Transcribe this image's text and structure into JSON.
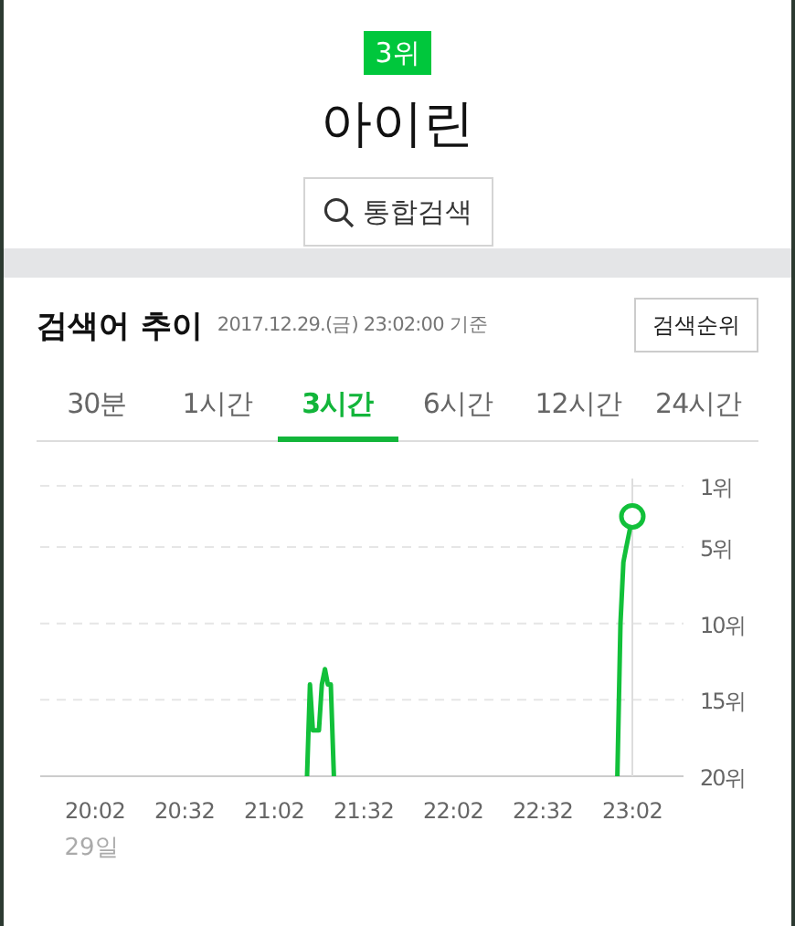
{
  "rank_badge": "3위",
  "keyword": "아이린",
  "search_button": {
    "label": "통합검색"
  },
  "trend": {
    "title": "검색어 추이",
    "timestamp": "2017.12.29.(금) 23:02:00 기준",
    "rank_button": "검색순위",
    "tabs": [
      {
        "label": "30분",
        "selected": false
      },
      {
        "label": "1시간",
        "selected": false
      },
      {
        "label": "3시간",
        "selected": true
      },
      {
        "label": "6시간",
        "selected": false
      },
      {
        "label": "12시간",
        "selected": false
      },
      {
        "label": "24시간",
        "selected": false
      }
    ],
    "date_label": "29일",
    "chart_data": {
      "type": "line",
      "categories": [
        "20:02",
        null,
        null,
        null,
        null,
        null,
        null,
        null,
        null,
        null,
        null,
        null,
        null,
        null,
        null,
        null,
        null,
        null,
        null,
        null,
        null,
        null,
        null,
        null,
        null,
        null,
        null,
        null,
        null,
        null,
        "20:32",
        null,
        null,
        null,
        null,
        null,
        null,
        null,
        null,
        null,
        null,
        null,
        null,
        null,
        null,
        null,
        null,
        null,
        null,
        null,
        null,
        null,
        null,
        null,
        null,
        null,
        null,
        null,
        null,
        null,
        "21:02",
        null,
        null,
        null,
        null,
        null,
        null,
        null,
        null,
        null,
        null,
        null,
        null,
        null,
        null,
        null,
        null,
        null,
        null,
        null,
        null,
        null,
        null,
        null,
        null,
        null,
        null,
        null,
        null,
        null,
        "21:32",
        null,
        null,
        null,
        null,
        null,
        null,
        null,
        null,
        null,
        null,
        null,
        null,
        null,
        null,
        null,
        null,
        null,
        null,
        null,
        null,
        null,
        null,
        null,
        null,
        null,
        null,
        null,
        null,
        null,
        "22:02",
        null,
        null,
        null,
        null,
        null,
        null,
        null,
        null,
        null,
        null,
        null,
        null,
        null,
        null,
        null,
        null,
        null,
        null,
        null,
        null,
        null,
        null,
        null,
        null,
        null,
        null,
        null,
        null,
        null,
        "22:32",
        null,
        null,
        null,
        null,
        null,
        null,
        null,
        null,
        null,
        null,
        null,
        null,
        null,
        null,
        null,
        null,
        null,
        null,
        null,
        null,
        null,
        null,
        null,
        null,
        null,
        null,
        null,
        null,
        null,
        "23:02"
      ],
      "series": [
        {
          "color": "#12c03a",
          "values": [
            null,
            null,
            null,
            null,
            null,
            null,
            null,
            null,
            null,
            null,
            null,
            null,
            null,
            null,
            null,
            null,
            null,
            null,
            null,
            null,
            null,
            null,
            null,
            null,
            null,
            null,
            null,
            null,
            null,
            null,
            null,
            null,
            null,
            null,
            null,
            null,
            null,
            null,
            null,
            null,
            null,
            null,
            null,
            null,
            null,
            null,
            null,
            null,
            null,
            null,
            null,
            null,
            null,
            null,
            null,
            null,
            null,
            null,
            null,
            null,
            null,
            null,
            null,
            null,
            null,
            null,
            null,
            null,
            null,
            null,
            null,
            20,
            14,
            17,
            17,
            17,
            14,
            13,
            14,
            14,
            20,
            null,
            null,
            null,
            null,
            null,
            null,
            null,
            null,
            null,
            null,
            null,
            null,
            null,
            null,
            null,
            null,
            null,
            null,
            null,
            null,
            null,
            null,
            null,
            null,
            null,
            null,
            null,
            null,
            null,
            null,
            null,
            null,
            null,
            null,
            null,
            null,
            null,
            null,
            null,
            null,
            null,
            null,
            null,
            null,
            null,
            null,
            null,
            null,
            null,
            null,
            null,
            null,
            null,
            null,
            null,
            null,
            null,
            null,
            null,
            null,
            null,
            null,
            null,
            null,
            null,
            null,
            null,
            null,
            null,
            null,
            null,
            null,
            null,
            null,
            null,
            null,
            null,
            null,
            null,
            null,
            null,
            null,
            null,
            null,
            null,
            null,
            null,
            null,
            null,
            null,
            null,
            null,
            null,
            null,
            20,
            10,
            6,
            5,
            4,
            3
          ]
        }
      ],
      "grid": true,
      "ylim": [
        20,
        1
      ],
      "yticks": [
        {
          "value": 1,
          "label": "1위"
        },
        {
          "value": 5,
          "label": "5위"
        },
        {
          "value": 10,
          "label": "10위"
        },
        {
          "value": 15,
          "label": "15위"
        },
        {
          "value": 20,
          "label": "20위"
        }
      ]
    }
  }
}
